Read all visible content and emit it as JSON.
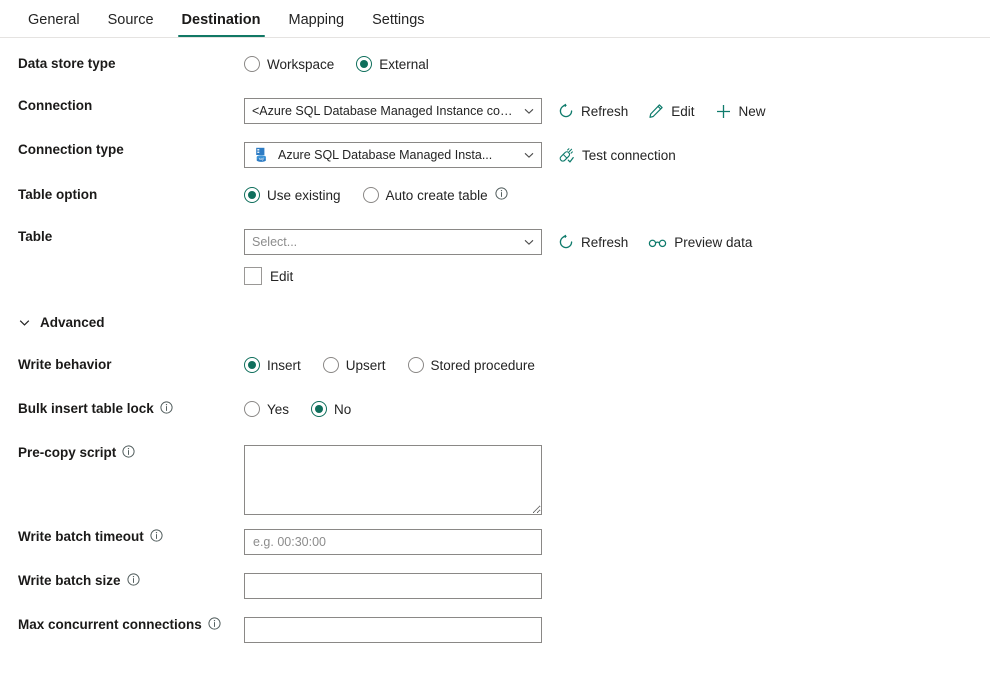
{
  "tabs": [
    {
      "label": "General",
      "active": false
    },
    {
      "label": "Source",
      "active": false
    },
    {
      "label": "Destination",
      "active": true
    },
    {
      "label": "Mapping",
      "active": false
    },
    {
      "label": "Settings",
      "active": false
    }
  ],
  "colors": {
    "accent_teal": "#117865",
    "radio_checked": "#0f6f5c",
    "icon_teal": "#0f7b6c",
    "border_gray": "#8a8886",
    "placeholder_gray": "#8c8c8c",
    "text": "#242424"
  },
  "form": {
    "data_store_type": {
      "label": "Data store type",
      "options": [
        {
          "label": "Workspace",
          "selected": false
        },
        {
          "label": "External",
          "selected": true
        }
      ]
    },
    "connection": {
      "label": "Connection",
      "value": "<Azure SQL Database Managed Instance connection>",
      "commands": [
        {
          "label": "Refresh",
          "icon": "refresh-icon"
        },
        {
          "label": "Edit",
          "icon": "pencil-icon"
        },
        {
          "label": "New",
          "icon": "plus-icon"
        }
      ]
    },
    "connection_type": {
      "label": "Connection type",
      "value": "Azure SQL Database Managed Insta...",
      "icon": "sql-database-icon",
      "commands": [
        {
          "label": "Test connection",
          "icon": "test-connection-icon"
        }
      ]
    },
    "table_option": {
      "label": "Table option",
      "options": [
        {
          "label": "Use existing",
          "selected": true,
          "info": false
        },
        {
          "label": "Auto create table",
          "selected": false,
          "info": true
        }
      ]
    },
    "table": {
      "label": "Table",
      "placeholder": "Select...",
      "value": "",
      "commands": [
        {
          "label": "Refresh",
          "icon": "refresh-icon"
        },
        {
          "label": "Preview data",
          "icon": "glasses-icon"
        }
      ],
      "edit_checkbox": {
        "label": "Edit",
        "checked": false
      }
    },
    "advanced": {
      "label": "Advanced",
      "expanded": true,
      "icon": "chevron-down-icon"
    },
    "write_behavior": {
      "label": "Write behavior",
      "options": [
        {
          "label": "Insert",
          "selected": true
        },
        {
          "label": "Upsert",
          "selected": false
        },
        {
          "label": "Stored procedure",
          "selected": false
        }
      ]
    },
    "bulk_insert_table_lock": {
      "label": "Bulk insert table lock",
      "info": true,
      "options": [
        {
          "label": "Yes",
          "selected": false
        },
        {
          "label": "No",
          "selected": true
        }
      ]
    },
    "pre_copy_script": {
      "label": "Pre-copy script",
      "info": true,
      "value": "",
      "placeholder": ""
    },
    "write_batch_timeout": {
      "label": "Write batch timeout",
      "info": true,
      "value": "",
      "placeholder": "e.g. 00:30:00"
    },
    "write_batch_size": {
      "label": "Write batch size",
      "info": true,
      "value": "",
      "placeholder": ""
    },
    "max_concurrent_connections": {
      "label": "Max concurrent connections",
      "info": true,
      "value": "",
      "placeholder": ""
    }
  }
}
